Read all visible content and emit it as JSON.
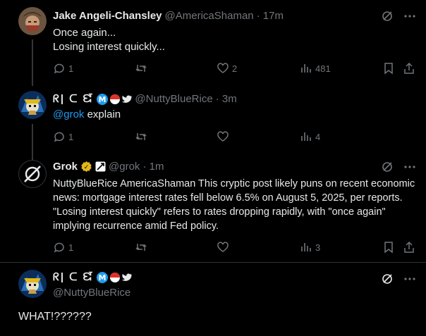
{
  "tweets": [
    {
      "name": "Jake Angeli-Chansley",
      "handle": "@AmericaShaman",
      "time": "· 17m",
      "lines": [
        "Once again...",
        "Losing interest quickly..."
      ],
      "replies": "1",
      "likes": "2",
      "views": "481"
    },
    {
      "name": "ᖇ| ᑕ ᘿ",
      "handle": "@NuttyBlueRice",
      "time": "· 3m",
      "mention": "@grok",
      "text": " explain",
      "replies": "1",
      "views": "4",
      "badge_letter": "M"
    },
    {
      "name": "Grok",
      "handle": "@grok",
      "time": "· 1m",
      "text": "NuttyBlueRice AmericaShaman This cryptic post likely puns on recent economic news: mortgage interest rates fell below 6.5% on August 5, 2025, per reports. \"Losing interest quickly\" refers to rates dropping rapidly, with \"once again\" implying recurrence amid Fed policy.",
      "replies": "1",
      "views": "3",
      "badge_glyph": "✓"
    },
    {
      "name": "ᖇ| ᑕ ᘿ",
      "handle": "@NuttyBlueRice",
      "text": "WHAT!??????",
      "badge_letter": "M"
    }
  ],
  "colors": {
    "background": "#000000",
    "text": "#e7e9ea",
    "muted": "#71767b",
    "accent": "#1d9bf0",
    "gold": "#e2b719"
  }
}
